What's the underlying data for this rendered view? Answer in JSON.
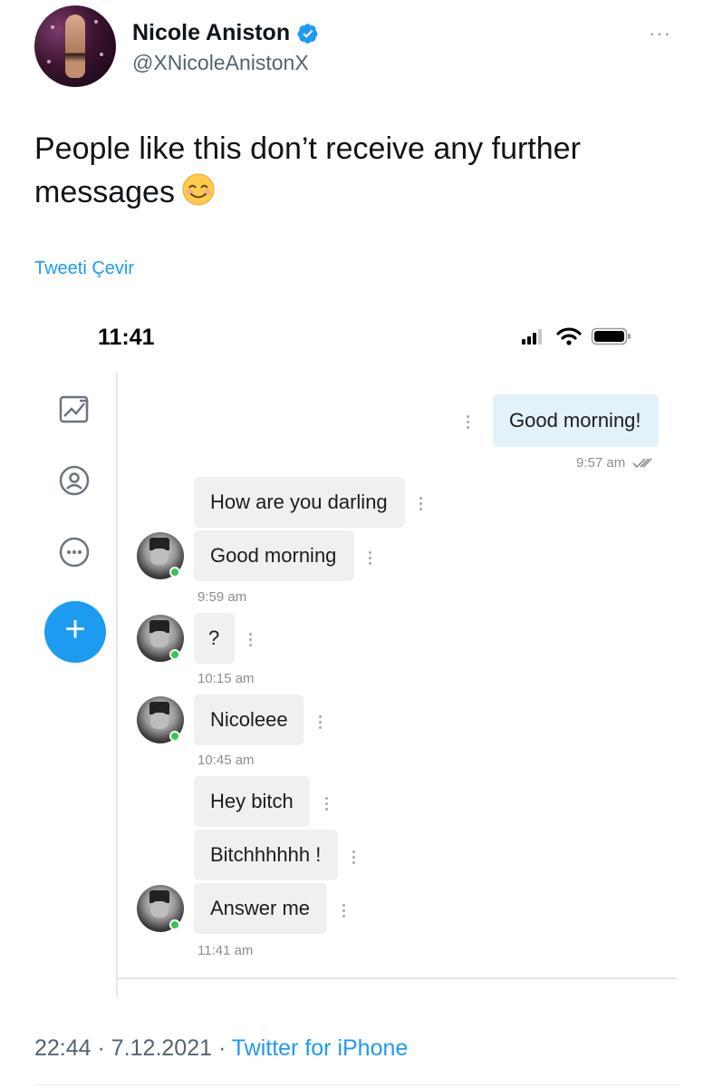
{
  "tweet": {
    "author_name": "Nicole Aniston",
    "author_handle": "@XNicoleAnistonX",
    "more_label": "···",
    "text": "People like this don’t receive any further messages",
    "emoji": "smiling-face-emoji",
    "translate_label": "Tweeti Çevir",
    "time": "22:44",
    "separator": " · ",
    "date": "7.12.2021",
    "source": "Twitter for iPhone"
  },
  "phone": {
    "clock": "11:41",
    "fab_label": "+",
    "side_icons": [
      "image-chart-icon",
      "profile-icon",
      "more-circle-icon"
    ],
    "messages": [
      {
        "id": "m1",
        "text": "Good morning!",
        "mine": true
      },
      {
        "id": "m2",
        "text": "How are you darling",
        "mine": false
      },
      {
        "id": "m3",
        "text": "Good morning",
        "mine": false
      },
      {
        "id": "m4",
        "text": "?",
        "mine": false
      },
      {
        "id": "m5",
        "text": "Nicoleee",
        "mine": false
      },
      {
        "id": "m6",
        "text": "Hey bitch",
        "mine": false
      },
      {
        "id": "m7",
        "text": "Bitchhhhhh !",
        "mine": false
      },
      {
        "id": "m8",
        "text": "Answer me",
        "mine": false
      }
    ],
    "timestamps": [
      "9:57 am",
      "9:59 am",
      "10:15 am",
      "10:45 am",
      "11:41 am"
    ]
  },
  "colors": {
    "accent": "#1d9bf0",
    "my_bubble": "#e3f2fa",
    "their_bubble": "#f0f0f0",
    "online": "#35c759"
  }
}
